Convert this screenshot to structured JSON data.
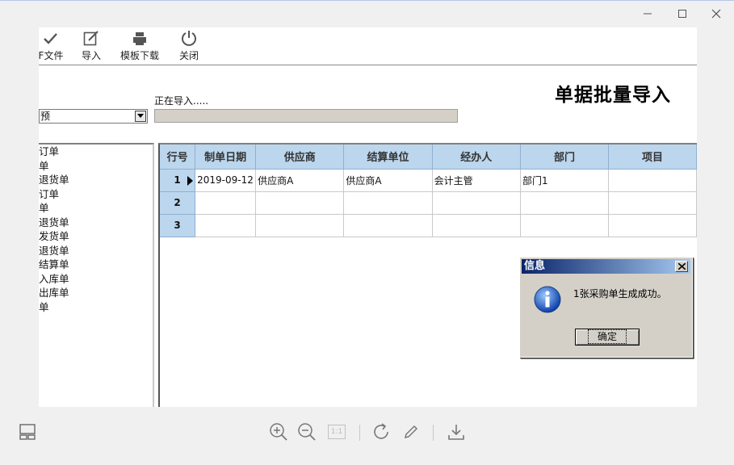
{
  "window": {
    "minimize_icon": "minimize-icon",
    "maximize_icon": "maximize-icon",
    "close_icon": "close-icon"
  },
  "toolbar": {
    "items": [
      {
        "label": "F文件",
        "icon": "check-icon"
      },
      {
        "label": "导入",
        "icon": "edit-icon"
      },
      {
        "label": "模板下载",
        "icon": "printer-icon"
      },
      {
        "label": "关闭",
        "icon": "power-icon"
      }
    ]
  },
  "header": {
    "title": "单据批量导入",
    "importing_text": "正在导入.....",
    "select_value": "预"
  },
  "left_list": {
    "items": [
      "订单",
      "单",
      "退货单",
      "订单",
      "单",
      "退货单",
      "发货单",
      "退货单",
      "结算单",
      "入库单",
      "出库单",
      "单"
    ]
  },
  "grid": {
    "columns": [
      "行号",
      "制单日期",
      "供应商",
      "结算单位",
      "经办人",
      "部门",
      "项目"
    ],
    "rows": [
      {
        "num": "1",
        "date": "2019-09-12",
        "supplier": "供应商A",
        "settle": "供应商A",
        "handler": "会计主管",
        "dept": "部门1",
        "project": ""
      },
      {
        "num": "2",
        "date": "",
        "supplier": "",
        "settle": "",
        "handler": "",
        "dept": "",
        "project": ""
      },
      {
        "num": "3",
        "date": "",
        "supplier": "",
        "settle": "",
        "handler": "",
        "dept": "",
        "project": ""
      }
    ]
  },
  "dialog": {
    "title": "信息",
    "message": "1张采购单生成成功。",
    "ok_label": "确定"
  },
  "viewer_toolbar": {
    "icons": [
      "layout-icon",
      "zoom-in-icon",
      "zoom-out-icon",
      "actual-size-icon",
      "rotate-icon",
      "pen-icon",
      "download-icon"
    ],
    "actual_size_label": "1:1"
  },
  "colors": {
    "grid_header": "#bcd6ee",
    "dialog_title_start": "#0a246a",
    "dialog_title_end": "#a6caf0"
  }
}
